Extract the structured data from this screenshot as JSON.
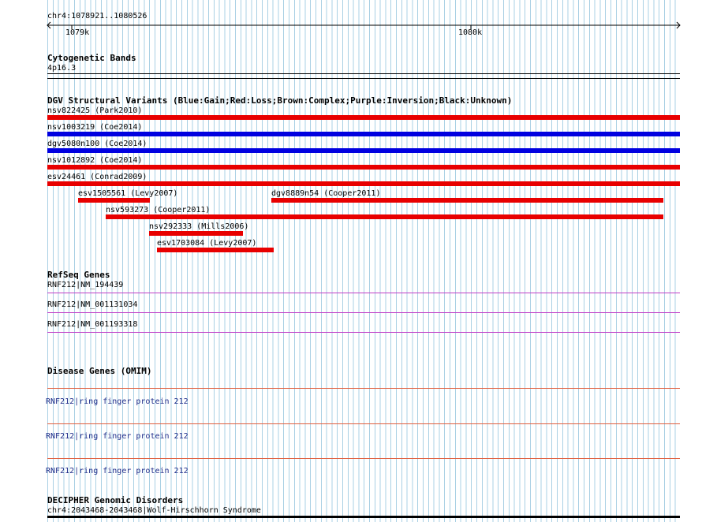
{
  "coordinates": {
    "range": "chr4:1078921..1080526",
    "tick1": "1079k",
    "tick2": "1080k"
  },
  "cytobands": {
    "title": "Cytogenetic Bands",
    "band": "4p16.3"
  },
  "dgv": {
    "title": "DGV Structural Variants (Blue:Gain;Red:Loss;Brown:Complex;Purple:Inversion;Black:Unknown)",
    "colors": {
      "gain": "#0000e0",
      "loss": "#e80000"
    },
    "variants": [
      {
        "label": "nsv822425 (Park2010)",
        "type": "loss"
      },
      {
        "label": "nsv1003219 (Coe2014)",
        "type": "gain"
      },
      {
        "label": "dgv5080n100 (Coe2014)",
        "type": "gain"
      },
      {
        "label": "nsv1012892 (Coe2014)",
        "type": "loss"
      },
      {
        "label": "esv24461 (Conrad2009)",
        "type": "loss"
      },
      {
        "label": "esv1505561 (Levy2007)",
        "type": "loss"
      },
      {
        "label": "dgv8889n54 (Cooper2011)",
        "type": "loss"
      },
      {
        "label": "nsv593273 (Cooper2011)",
        "type": "loss"
      },
      {
        "label": "nsv292333 (Mills2006)",
        "type": "loss"
      },
      {
        "label": "esv1703084 (Levy2007)",
        "type": "loss"
      }
    ]
  },
  "refseq": {
    "title": "RefSeq Genes",
    "color": "#c040c8",
    "genes": [
      {
        "label": "RNF212|NM_194439"
      },
      {
        "label": "RNF212|NM_001131034"
      },
      {
        "label": "RNF212|NM_001193318"
      }
    ]
  },
  "omim": {
    "title": "Disease Genes (OMIM)",
    "color": "#e06040",
    "genes": [
      {
        "label": "RNF212|ring finger protein 212"
      },
      {
        "label": "RNF212|ring finger protein 212"
      },
      {
        "label": "RNF212|ring finger protein 212"
      }
    ]
  },
  "decipher": {
    "title": "DECIPHER Genomic Disorders",
    "entry": "chr4:2043468-2043468|Wolf-Hirschhorn Syndrome"
  }
}
